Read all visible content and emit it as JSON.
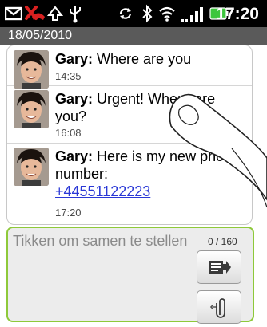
{
  "status_bar": {
    "time": "17:20",
    "icons": [
      "message-icon",
      "missed-call-icon",
      "upload-icon",
      "usb-icon",
      "sync-icon",
      "bluetooth-icon",
      "wifi-icon",
      "signal-icon",
      "battery-icon"
    ]
  },
  "thread": {
    "date": "18/05/2010",
    "messages": [
      {
        "sender": "Gary:",
        "text": " Where are you",
        "time": "14:35"
      },
      {
        "sender": "Gary:",
        "text": " Urgent! Where are you?",
        "time": "16:08"
      },
      {
        "sender": "Gary:",
        "text": " Here is my new phone number:",
        "link": "+44551122223",
        "time": "17:20"
      }
    ]
  },
  "composer": {
    "placeholder": "Tikken om samen te stellen",
    "counter": "0 / 160",
    "send_icon": "send-icon",
    "attach_icon": "paperclip-icon"
  },
  "colors": {
    "status_bar_bg": "#000000",
    "date_bar_bg": "#5a5a5a",
    "composer_border": "#8ec93a",
    "link": "#2a38d6",
    "missed_call": "#d92020"
  }
}
